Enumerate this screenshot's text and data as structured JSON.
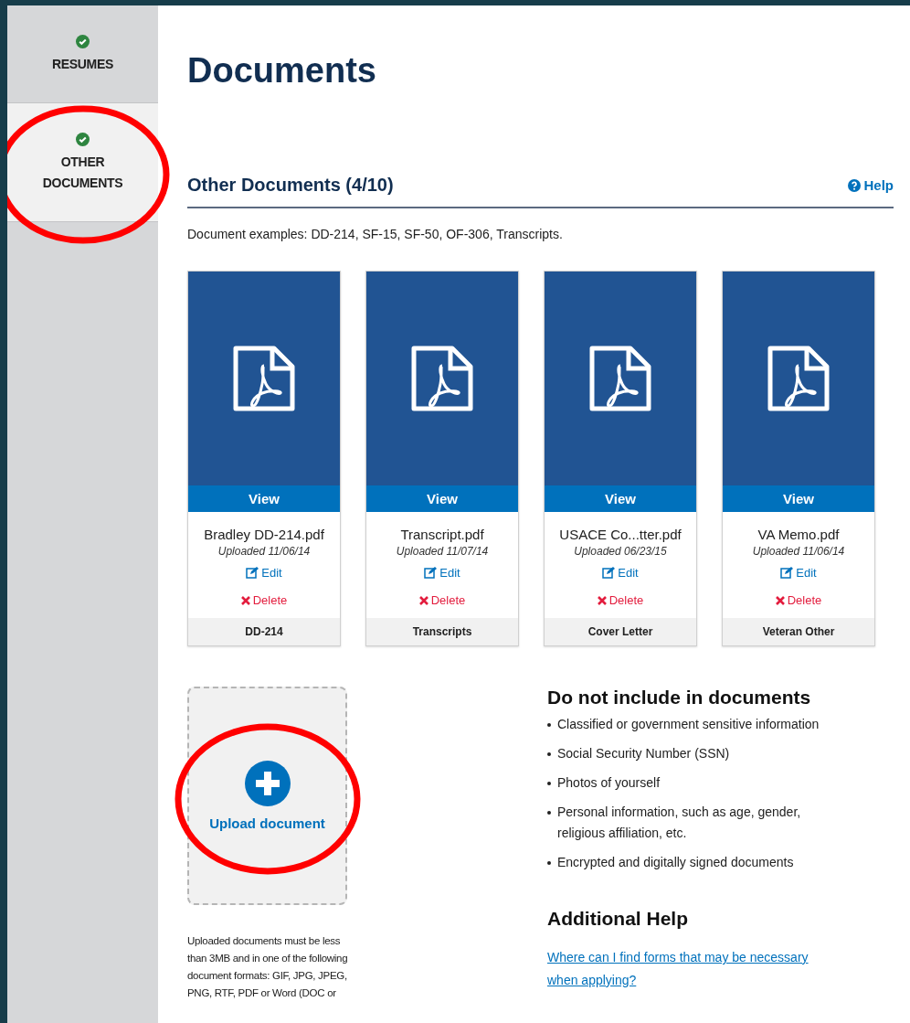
{
  "sidebar": {
    "items": [
      {
        "label": "RESUMES",
        "complete": true,
        "selected": false,
        "highlighted": false
      },
      {
        "label": "OTHER DOCUMENTS",
        "complete": true,
        "selected": true,
        "highlighted": true
      }
    ]
  },
  "page_title": "Documents",
  "section": {
    "title": "Other Documents (4/10)",
    "help": "Help",
    "examples": "Document examples: DD-214, SF-15, SF-50, OF-306, Transcripts."
  },
  "documents": [
    {
      "view": "View",
      "filename": "Bradley DD-214.pdf",
      "uploaded": "Uploaded 11/06/14",
      "edit": "Edit",
      "delete": "Delete",
      "type": "DD-214"
    },
    {
      "view": "View",
      "filename": "Transcript.pdf",
      "uploaded": "Uploaded 11/07/14",
      "edit": "Edit",
      "delete": "Delete",
      "type": "Transcripts"
    },
    {
      "view": "View",
      "filename": "USACE Co...tter.pdf",
      "uploaded": "Uploaded 06/23/15",
      "edit": "Edit",
      "delete": "Delete",
      "type": "Cover Letter"
    },
    {
      "view": "View",
      "filename": "VA Memo.pdf",
      "uploaded": "Uploaded 11/06/14",
      "edit": "Edit",
      "delete": "Delete",
      "type": "Veteran Other"
    }
  ],
  "upload": {
    "label": "Upload document",
    "highlighted": true,
    "note": "Uploaded documents must be less than 3MB and in one of the following document formats: GIF, JPG, JPEG, PNG, RTF, PDF or Word (DOC or"
  },
  "do_not_include": {
    "title": "Do not include in documents",
    "items": [
      "Classified or government sensitive information",
      "Social Security Number (SSN)",
      "Photos of yourself",
      "Personal information, such as age, gender, religious affiliation, etc.",
      "Encrypted and digitally signed documents"
    ]
  },
  "additional_help": {
    "title": "Additional Help",
    "link": "Where can I find forms that may be necessary when applying?"
  }
}
